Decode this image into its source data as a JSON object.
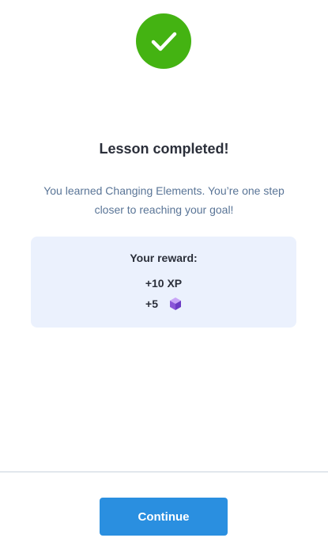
{
  "header": {
    "icon": "checkmark-circle-icon",
    "icon_color": "#44b312"
  },
  "lesson": {
    "title": "Lesson completed!",
    "message": "You learned Changing Elements. You’re one step closer to reaching your goal!"
  },
  "reward": {
    "title": "Your reward:",
    "xp": "+10 XP",
    "gems": "+5",
    "gem_icon": "gem-cube-icon",
    "box_color": "#ebf1fd"
  },
  "footer": {
    "continue_label": "Continue",
    "button_color": "#2a8fe0"
  }
}
